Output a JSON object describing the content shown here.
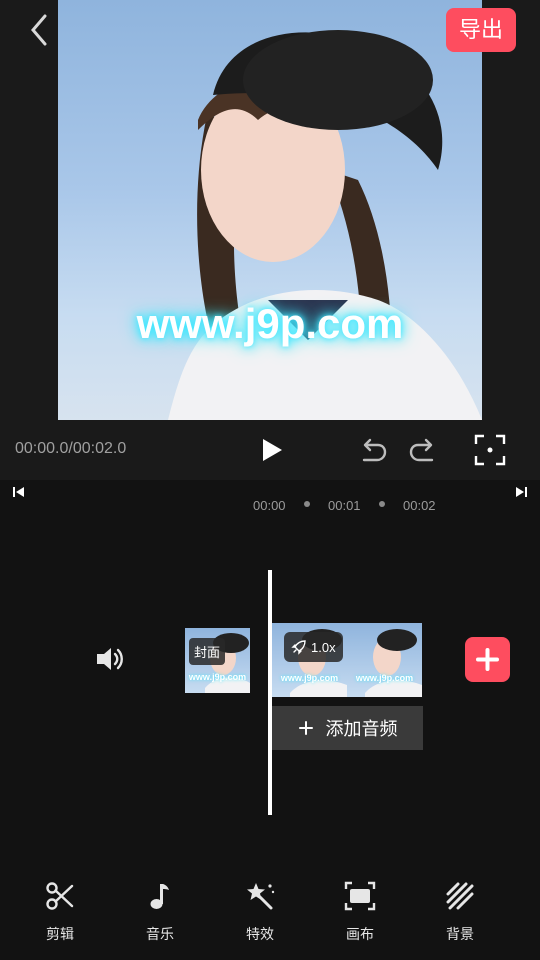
{
  "header": {
    "export_label": "导出"
  },
  "preview": {
    "watermark_text": "www.j9p.com"
  },
  "controls": {
    "time_readout": "00:00.0/00:02.0"
  },
  "timeline": {
    "ruler": [
      "00:00",
      "00:01",
      "00:02"
    ],
    "cover_label": "封面",
    "speed_label": "1.0x",
    "add_audio_label": "添加音频",
    "clip_watermark": "www.j9p.com"
  },
  "toolbar": {
    "items": [
      {
        "label": "剪辑",
        "icon": "scissors-icon"
      },
      {
        "label": "音乐",
        "icon": "music-note-icon"
      },
      {
        "label": "特效",
        "icon": "magic-wand-icon"
      },
      {
        "label": "画布",
        "icon": "canvas-frame-icon"
      },
      {
        "label": "背景",
        "icon": "stripes-icon"
      }
    ]
  },
  "colors": {
    "accent": "#fe4d5f",
    "background": "#121212"
  }
}
